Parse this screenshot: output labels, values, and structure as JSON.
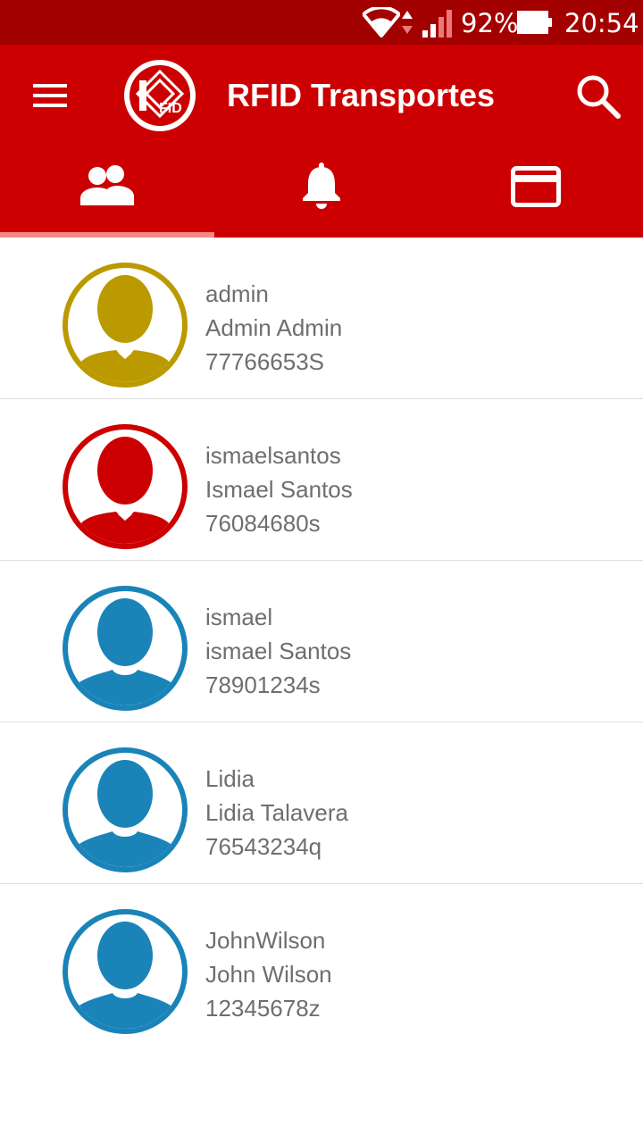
{
  "status_bar": {
    "battery": "92%",
    "time": "20:54",
    "icons": [
      "wifi-icon",
      "data-updown-icon",
      "signal-icon",
      "battery-icon"
    ]
  },
  "app_bar": {
    "title": "RFID Transportes",
    "logo_text": "FID",
    "icons": [
      "menu-icon",
      "search-icon"
    ],
    "color": "#cc0000"
  },
  "tabs": [
    {
      "icon": "people-icon",
      "selected": true
    },
    {
      "icon": "bell-icon",
      "selected": false
    },
    {
      "icon": "card-icon",
      "selected": false
    }
  ],
  "users": [
    {
      "username": "admin",
      "full_name": "Admin Admin",
      "id": "77766653S",
      "avatar": "user-tie-avatar",
      "color": "#bb9a00"
    },
    {
      "username": "ismaelsantos",
      "full_name": "Ismael Santos",
      "id": "76084680s",
      "avatar": "user-tie-avatar",
      "color": "#cc0000"
    },
    {
      "username": "ismael",
      "full_name": "ismael Santos",
      "id": "78901234s",
      "avatar": "user-avatar",
      "color": "#1a84b8"
    },
    {
      "username": "Lidia",
      "full_name": "Lidia Talavera",
      "id": "76543234q",
      "avatar": "user-avatar",
      "color": "#1a84b8"
    },
    {
      "username": "JohnWilson",
      "full_name": "John Wilson",
      "id": "12345678z",
      "avatar": "user-avatar",
      "color": "#1a84b8"
    }
  ]
}
